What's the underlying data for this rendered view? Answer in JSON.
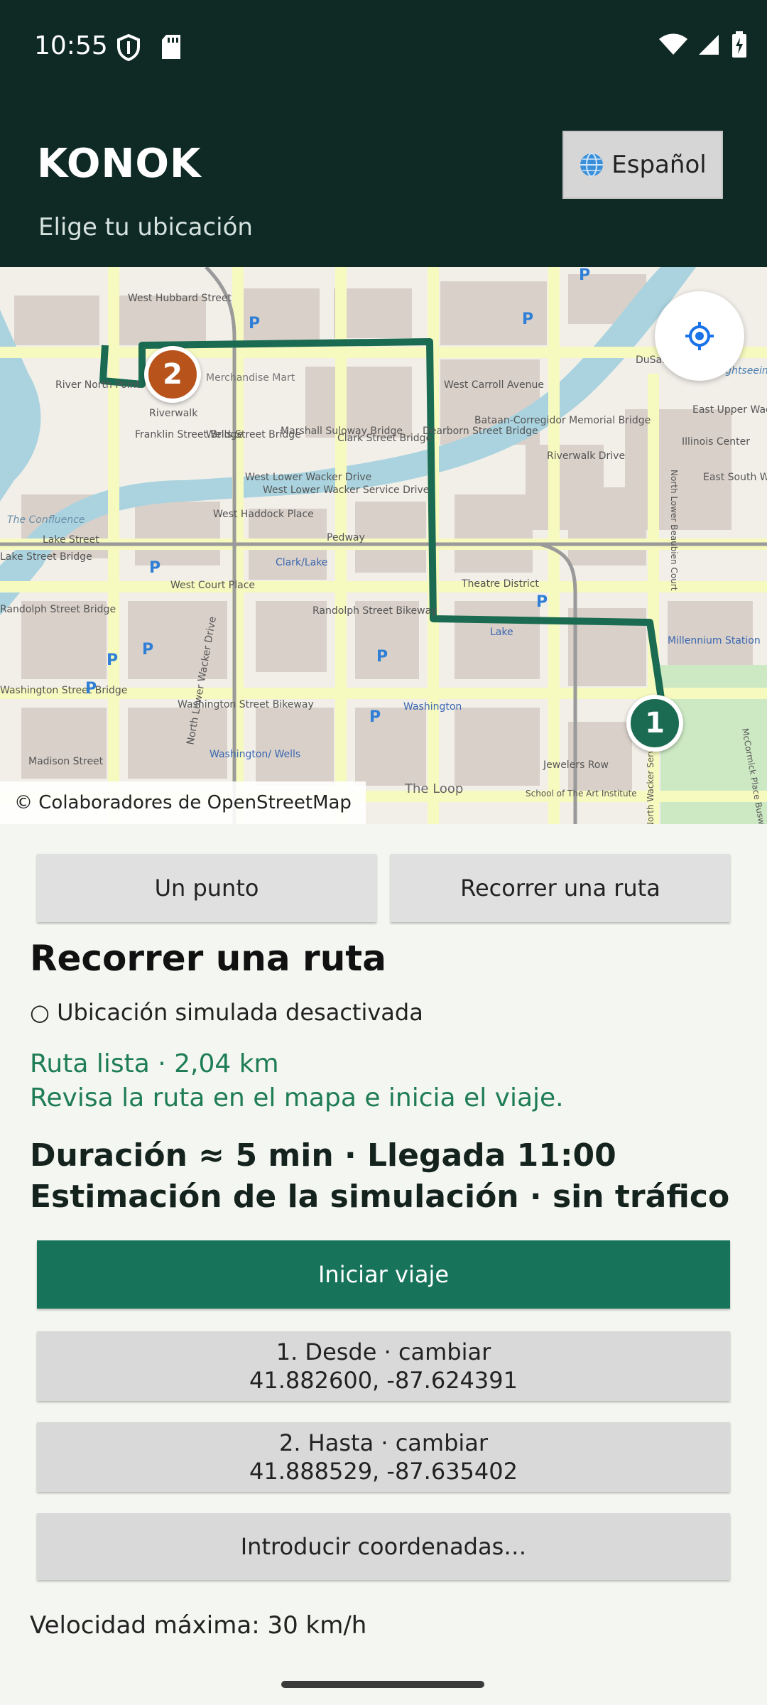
{
  "status_bar": {
    "time": "10:55"
  },
  "header": {
    "title": "KONOK",
    "subtitle": "Elige tu ubicación",
    "language_button": "Español"
  },
  "map": {
    "attribution": "© Colaboradores de OpenStreetMap",
    "markers": {
      "start": "1",
      "end": "2"
    },
    "labels": {
      "west_hubbard": "West Hubbard Street",
      "merchandise_mart": "Merchandise Mart",
      "riverwalk": "Riverwalk",
      "river_north": "River North Point",
      "franklin_bridge": "Franklin Street Bridge",
      "wells_bridge": "Wells Street Bridge",
      "marshall_bridge": "Marshall Suloway Bridge",
      "clark_bridge": "Clark Street Bridge",
      "dearborn_bridge": "Dearborn Street Bridge",
      "bataan": "Bataan-Corregidor Memorial Bridge",
      "carroll": "West Carroll Avenue",
      "riverwalk_drive": "Riverwalk Drive",
      "lower_wacker": "West Lower Wacker Drive",
      "lower_wacker_service": "West Lower Wacker Service Drive",
      "haddock": "West Haddock Place",
      "lake_street": "Lake Street",
      "lake_bridge": "Lake Street Bridge",
      "pedway": "Pedway",
      "clark_lake": "Clark/Lake",
      "theatre": "Theatre District",
      "court_place": "West Court Place",
      "randolph_bikeway": "Randolph Street Bikeway",
      "randolph_bridge": "Randolph Street Bridge",
      "washington_bridge": "Washington Street Bridge",
      "washington_bikeway": "Washington Street Bikeway",
      "washington": "Washington",
      "washington_wells": "Washington/ Wells",
      "madison": "Madison Street",
      "the_loop": "The Loop",
      "jewelers": "Jewelers Row",
      "lake": "Lake",
      "millennium": "Millennium Station",
      "illinois_center": "Illinois Center",
      "dusable": "DuSable Bridge",
      "east_upper_wacker": "East Upper Wacker",
      "east_south_wacker": "East South Wac",
      "north_wacker": "North Lower Wacker Drive",
      "north_wacker_service": "North Wacker Service Drive",
      "confluence": "The Confluence",
      "art_institute": "School of The Art Institute",
      "mccormick": "McCormick Place Busway",
      "beaubien": "North Lower Beaubien Court",
      "sightseeing": "sightseeing"
    }
  },
  "modes": {
    "single": "Un punto",
    "route": "Recorrer una ruta"
  },
  "section_title": "Recorrer una ruta",
  "simulation_status": "○ Ubicación simulada desactivada",
  "route": {
    "ready": "Ruta lista · 2,04 km",
    "hint": "Revisa la ruta en el mapa e inicia el viaje."
  },
  "eta": {
    "line1": "Duración ≈ 5 min · Llegada 11:00",
    "line2": "Estimación de la simulación · sin tráfico"
  },
  "start_button": "Iniciar viaje",
  "from": {
    "label": "1. Desde · cambiar",
    "coords": "41.882600, -87.624391"
  },
  "to": {
    "label": "2. Hasta · cambiar",
    "coords": "41.888529, -87.635402"
  },
  "coords_button": "Introducir coordenadas…",
  "speed": "Velocidad máxima: 30 km/h",
  "colors": {
    "header_bg": "#0f2a25",
    "accent": "#17735a",
    "route_line": "#1b6b52",
    "start_marker": "#1b6b52",
    "end_marker": "#b8531c",
    "status_text": "#1e7d55"
  }
}
